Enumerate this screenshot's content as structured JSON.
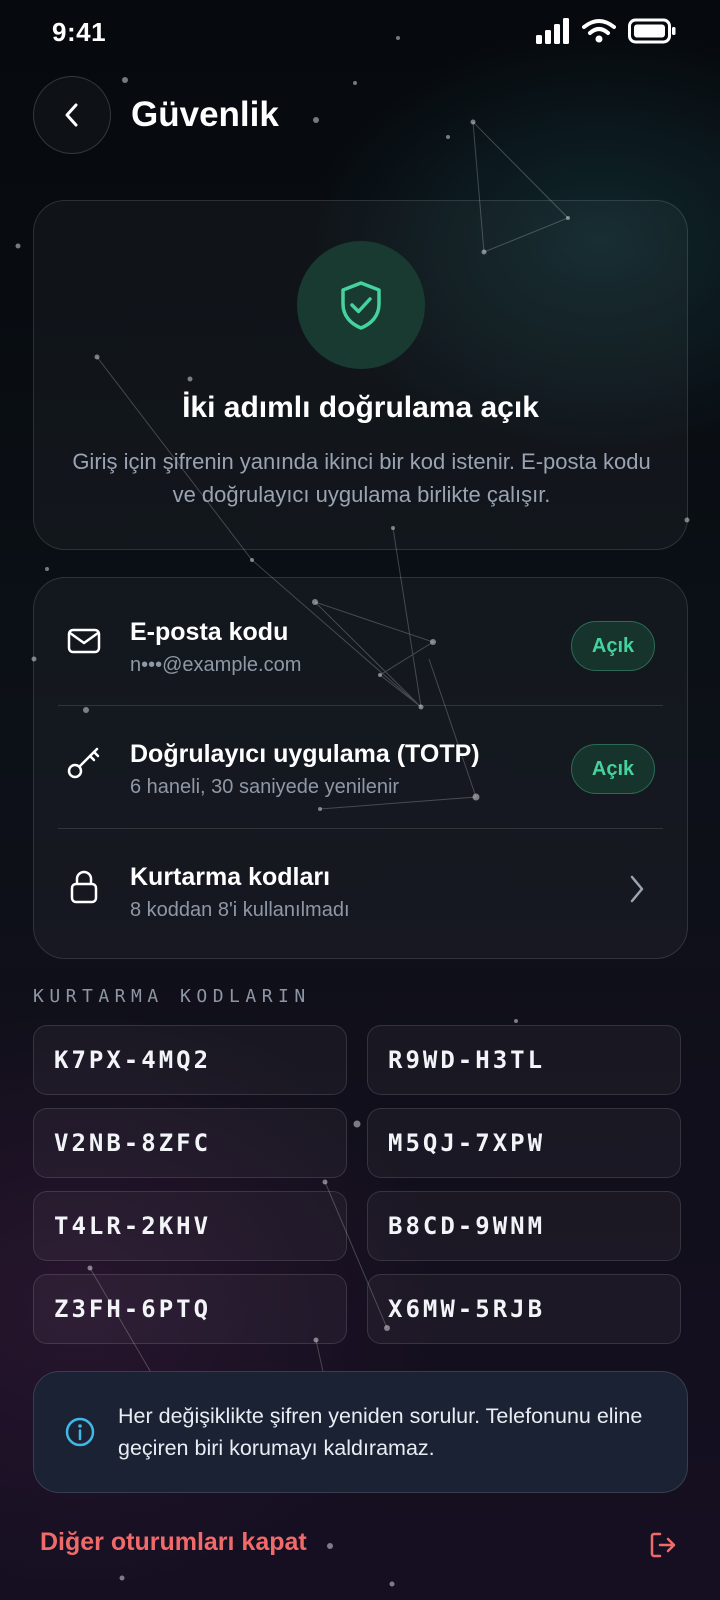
{
  "status_bar": {
    "time": "9:41",
    "icons": [
      "cellular-signal-icon",
      "wifi-icon",
      "battery-icon"
    ]
  },
  "header": {
    "back_icon": "chevron-left-icon",
    "title": "Güvenlik"
  },
  "hero": {
    "icon": "shield-check-icon",
    "title": "İki adımlı doğrulama açık",
    "description": "Giriş için şifrenin yanında ikinci bir kod istenir. E-posta kodu ve doğrulayıcı uygulama birlikte çalışır."
  },
  "methods": [
    {
      "icon": "mail-icon",
      "title": "E-posta kodu",
      "subtitle": "n•••@example.com",
      "status": "Açık"
    },
    {
      "icon": "key-icon",
      "title": "Doğrulayıcı uygulama (TOTP)",
      "subtitle": "6 haneli, 30 saniyede yenilenir",
      "status": "Açık"
    },
    {
      "icon": "lock-icon",
      "title": "Kurtarma kodları",
      "subtitle": "8 koddan 8'i kullanılmadı",
      "action_icon": "chevron-right-icon"
    }
  ],
  "recovery": {
    "label": "KURTARMA KODLARIN",
    "codes": [
      "K7PX-4MQ2",
      "R9WD-H3TL",
      "V2NB-8ZFC",
      "M5QJ-7XPW",
      "T4LR-2KHV",
      "B8CD-9WNM",
      "Z3FH-6PTQ",
      "X6MW-5RJB"
    ]
  },
  "note": {
    "icon": "info-icon",
    "text": "Her değişiklikte şifren yeniden sorulur. Telefonunu eline geçiren biri korumayı kaldıramaz."
  },
  "footer": {
    "signout_label": "Diğer oturumları kapat",
    "signout_icon": "logout-icon"
  },
  "colors": {
    "accent_green": "#45d29f",
    "danger": "#f06a6a",
    "info": "#3fb8e8",
    "background": "#0b1016"
  }
}
